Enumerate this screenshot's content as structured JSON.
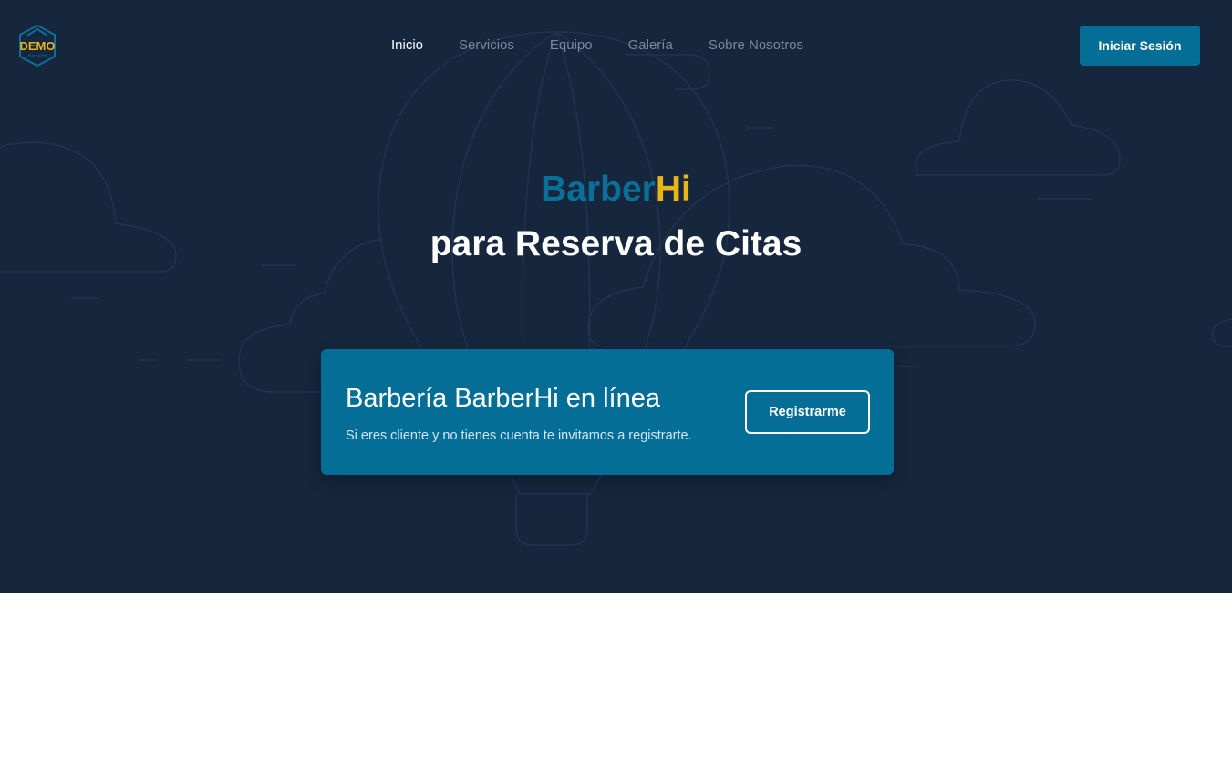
{
  "header": {
    "logo_text": "DEMO",
    "logo_sub": "BarberHi",
    "nav": [
      {
        "label": "Inicio",
        "active": true
      },
      {
        "label": "Servicios",
        "active": false
      },
      {
        "label": "Equipo",
        "active": false
      },
      {
        "label": "Galería",
        "active": false
      },
      {
        "label": "Sobre Nosotros",
        "active": false
      }
    ],
    "login_label": "Iniciar Sesión"
  },
  "hero": {
    "brand_part1": "Barber",
    "brand_part2": "Hi",
    "subtitle": "para Reserva de Citas"
  },
  "card": {
    "title": "Barbería BarberHi en línea",
    "text": "Si eres cliente y no tienes cuenta te invitamos a registrarte.",
    "button_label": "Registrarme"
  },
  "colors": {
    "background": "#15263d",
    "accent": "#056e97",
    "brand_yellow": "#e8b51d",
    "brand_blue": "#0b6f99"
  },
  "icons": [
    "logo-icon",
    "balloon-icon",
    "cloud-icon"
  ]
}
